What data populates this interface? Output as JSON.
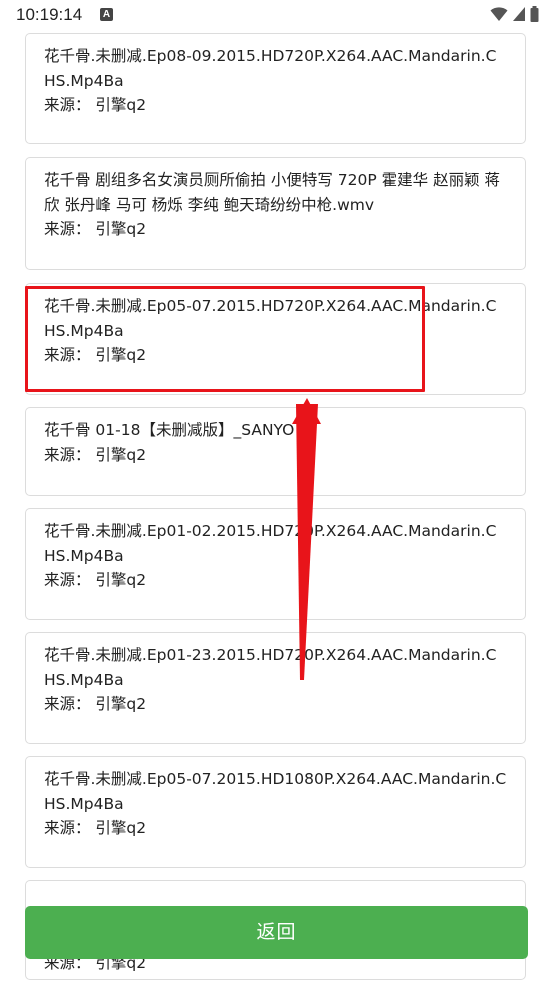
{
  "status_bar": {
    "time": "10:19:14",
    "notification_icon": "A"
  },
  "results": [
    {
      "title": "花千骨.未删减.Ep08-09.2015.HD720P.X264.AAC.Mandarin.CHS.Mp4Ba",
      "source": "来源： 引擎q2"
    },
    {
      "title": "花千骨 剧组多名女演员厕所偷拍 小便特写 720P 霍建华 赵丽颖 蒋欣 张丹峰 马可 杨烁 李纯 鲍天琦纷纷中枪.wmv",
      "source": "来源： 引擎q2"
    },
    {
      "title": "花千骨.未删减.Ep05-07.2015.HD720P.X264.AAC.Mandarin.CHS.Mp4Ba",
      "source": "来源： 引擎q2"
    },
    {
      "title": "花千骨 01-18【未删减版】_SANYO",
      "source": "来源： 引擎q2"
    },
    {
      "title": "花千骨.未删减.Ep01-02.2015.HD720P.X264.AAC.Mandarin.CHS.Mp4Ba",
      "source": "来源： 引擎q2"
    },
    {
      "title": "花千骨.未删减.Ep01-23.2015.HD720P.X264.AAC.Mandarin.CHS.Mp4Ba",
      "source": "来源： 引擎q2"
    },
    {
      "title": "花千骨.未删减.Ep05-07.2015.HD1080P.X264.AAC.Mandarin.CHS.Mp4Ba",
      "source": "来源： 引擎q2"
    },
    {
      "title": "",
      "source": "来源： 引擎q2"
    }
  ],
  "back_button": {
    "label": "返回"
  },
  "colors": {
    "accent_green": "#4caf50",
    "highlight_red": "#e8141a",
    "card_border": "#dcdcdc"
  }
}
